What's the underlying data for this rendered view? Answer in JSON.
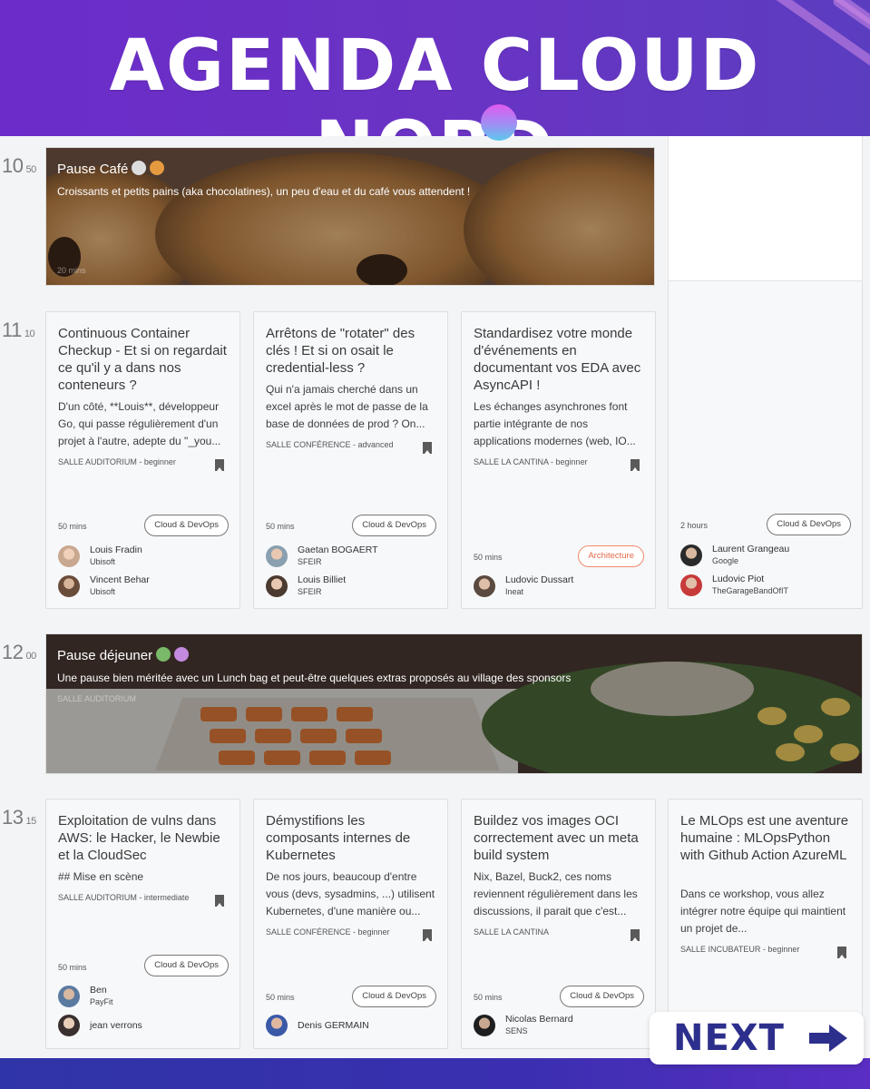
{
  "header": {
    "title": "AGENDA CLOUD NORD"
  },
  "times": [
    {
      "hour": "10",
      "min": "50"
    },
    {
      "hour": "11",
      "min": "10"
    },
    {
      "hour": "12",
      "min": "00"
    },
    {
      "hour": "13",
      "min": "15"
    }
  ],
  "banners": [
    {
      "title": "Pause Café",
      "desc": "Croissants et petits pains (aka chocolatines), un peu d'eau et du café vous attendent !",
      "small": "20 mins"
    },
    {
      "title": "Pause déjeuner",
      "desc": "Une pause bien méritée avec un Lunch bag et peut-être quelques extras proposés au village des sponsors",
      "small": "SALLE AUDITORIUM"
    }
  ],
  "sessions_1110": [
    {
      "title": "Continuous Container Checkup - Et si on regardait ce qu'il y a dans nos conteneurs ?",
      "desc": "D'un côté, **Louis**, développeur Go, qui passe régulièrement d'un projet à l'autre, adepte du \"_you...",
      "room": "SALLE AUDITORIUM - beginner",
      "duration": "50 mins",
      "tag": "Cloud & DevOps",
      "speakers": [
        {
          "name": "Louis Fradin",
          "org": "Ubisoft"
        },
        {
          "name": "Vincent Behar",
          "org": "Ubisoft"
        }
      ]
    },
    {
      "title": "Arrêtons de \"rotater\" des clés ! Et si on osait le credential-less ?",
      "desc": "Qui n'a jamais cherché dans un excel après le mot de passe de la base de données de prod ? On...",
      "room": "SALLE CONFÉRENCE - advanced",
      "duration": "50 mins",
      "tag": "Cloud & DevOps",
      "speakers": [
        {
          "name": "Gaetan BOGAERT",
          "org": "SFEIR"
        },
        {
          "name": "Louis Billiet",
          "org": "SFEIR"
        }
      ]
    },
    {
      "title": "Standardisez votre monde d'événements en documentant vos EDA avec AsyncAPI !",
      "desc": "Les échanges asynchrones font partie intégrante de nos applications modernes (web, IO...",
      "room": "SALLE LA CANTINA - beginner",
      "duration": "50 mins",
      "tag": "Architecture",
      "speakers": [
        {
          "name": "Ludovic Dussart",
          "org": "Ineat"
        }
      ]
    },
    {
      "duration": "2 hours",
      "tag": "Cloud & DevOps",
      "speakers": [
        {
          "name": "Laurent Grangeau",
          "org": "Google"
        },
        {
          "name": "Ludovic Piot",
          "org": "TheGarageBandOfIT"
        }
      ]
    }
  ],
  "sessions_1315": [
    {
      "title": "Exploitation de vulns dans AWS: le Hacker, le Newbie et la CloudSec",
      "desc": "## Mise en scène",
      "room": "SALLE AUDITORIUM - intermediate",
      "duration": "50 mins",
      "tag": "Cloud & DevOps",
      "speakers": [
        {
          "name": "Ben",
          "org": "PayFit"
        },
        {
          "name": "jean verrons",
          "org": ""
        }
      ]
    },
    {
      "title": "Démystifions les composants internes de Kubernetes",
      "desc": "De nos jours, beaucoup d'entre vous (devs, sysadmins, ...) utilisent Kubernetes, d'une manière ou...",
      "room": "SALLE CONFÉRENCE - beginner",
      "duration": "50 mins",
      "tag": "Cloud & DevOps",
      "speakers": [
        {
          "name": "Denis GERMAIN",
          "org": ""
        }
      ]
    },
    {
      "title": "Buildez vos images OCI correctement avec un meta build system",
      "desc": "Nix, Bazel, Buck2, ces noms reviennent régulièrement dans les discussions, il parait que c'est...",
      "room": "SALLE LA CANTINA",
      "duration": "50 mins",
      "tag": "Cloud & DevOps",
      "speakers": [
        {
          "name": "Nicolas Bernard",
          "org": "SENS"
        }
      ]
    },
    {
      "title": "Le MLOps est une aventure humaine : MLOpsPython with Github Action AzureML",
      "desc": "Dans ce workshop, vous allez intégrer notre équipe qui maintient un projet de...",
      "room": "SALLE INCUBATEUR - beginner"
    }
  ],
  "next_button": {
    "label": "NEXT"
  },
  "colors": {
    "header": "#6b2cc9",
    "next": "#2d2f8c",
    "architecture_tag": "#e5694a"
  },
  "icons": [
    "bookmark-icon",
    "arrow-right-icon",
    "coffee-icon",
    "croissant-icon",
    "salad-icon",
    "cupcake-icon"
  ]
}
